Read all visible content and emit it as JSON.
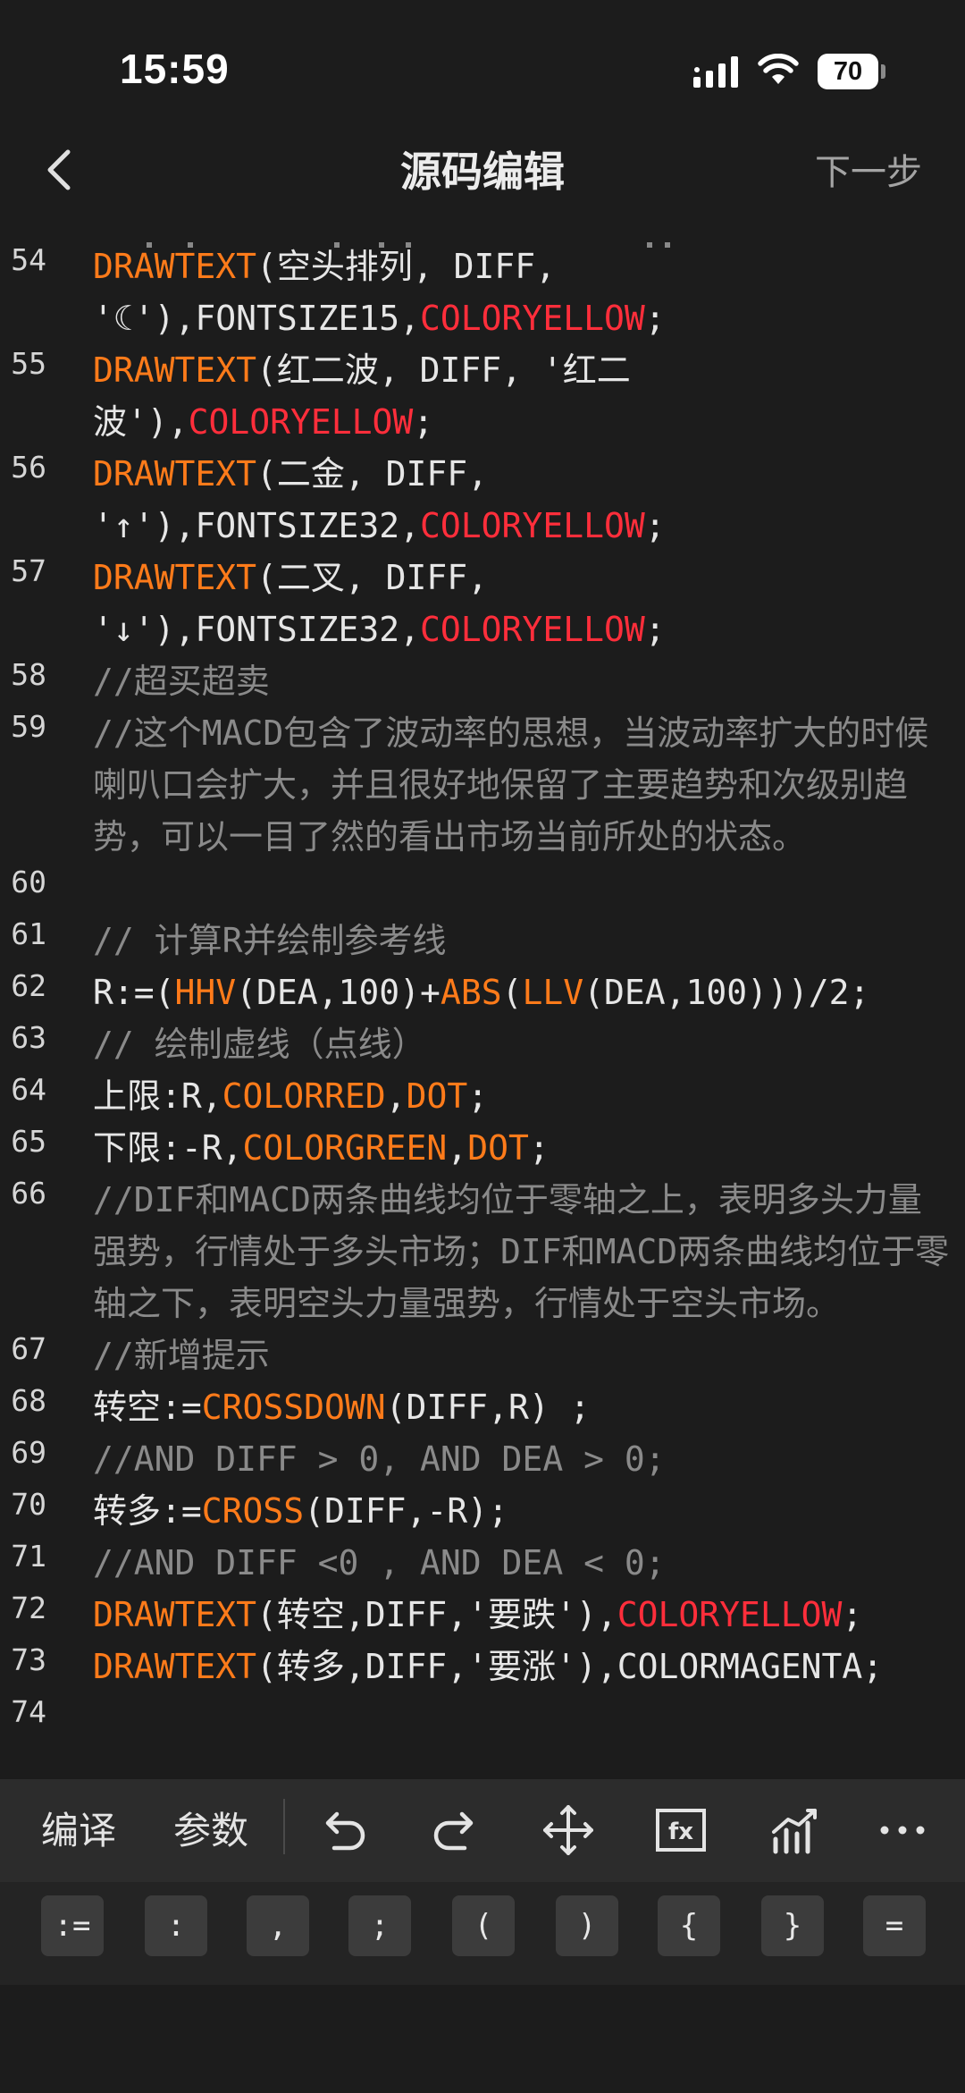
{
  "status_bar": {
    "time": "15:59",
    "battery": "70"
  },
  "nav": {
    "title": "源码编辑",
    "next_label": "下一步"
  },
  "editor": {
    "lines": [
      {
        "number": "54",
        "rows": [
          [
            [
              "fn",
              "DRAWTEXT"
            ],
            [
              "pl",
              "(空头排列, DIFF,"
            ]
          ],
          [
            [
              "pl",
              "'☾'),FONTSIZE15,"
            ],
            [
              "red",
              "COLORYELLOW"
            ],
            [
              "pl",
              ";"
            ]
          ]
        ]
      },
      {
        "number": "55",
        "rows": [
          [
            [
              "fn",
              "DRAWTEXT"
            ],
            [
              "pl",
              "(红二波, DIFF, '红二"
            ]
          ],
          [
            [
              "pl",
              "波'),"
            ],
            [
              "red",
              "COLORYELLOW"
            ],
            [
              "pl",
              ";"
            ]
          ]
        ]
      },
      {
        "number": "56",
        "rows": [
          [
            [
              "fn",
              "DRAWTEXT"
            ],
            [
              "pl",
              "(二金, DIFF,"
            ]
          ],
          [
            [
              "pl",
              "'↑'),FONTSIZE32,"
            ],
            [
              "red",
              "COLORYELLOW"
            ],
            [
              "pl",
              ";"
            ]
          ]
        ]
      },
      {
        "number": "57",
        "rows": [
          [
            [
              "fn",
              "DRAWTEXT"
            ],
            [
              "pl",
              "(二叉, DIFF,"
            ]
          ],
          [
            [
              "pl",
              "'↓'),FONTSIZE32,"
            ],
            [
              "red",
              "COLORYELLOW"
            ],
            [
              "pl",
              ";"
            ]
          ]
        ]
      },
      {
        "number": "58",
        "rows": [
          [
            [
              "cm",
              "//超买超卖"
            ]
          ]
        ]
      },
      {
        "number": "59",
        "rows": [
          [
            [
              "cm",
              "//这个MACD包含了波动率的思想，当波动率扩大的时候"
            ]
          ],
          [
            [
              "cm",
              "喇叭口会扩大，并且很好地保留了主要趋势和次级别趋"
            ]
          ],
          [
            [
              "cm",
              "势，可以一目了然的看出市场当前所处的状态。"
            ]
          ]
        ]
      },
      {
        "number": "60",
        "rows": [
          [
            [
              "pl",
              ""
            ]
          ]
        ]
      },
      {
        "number": "61",
        "rows": [
          [
            [
              "cm",
              "// 计算R并绘制参考线"
            ]
          ]
        ]
      },
      {
        "number": "62",
        "rows": [
          [
            [
              "pl",
              "R:=("
            ],
            [
              "fn",
              "HHV"
            ],
            [
              "pl",
              "(DEA,100)+"
            ],
            [
              "fn",
              "ABS"
            ],
            [
              "pl",
              "("
            ],
            [
              "fn",
              "LLV"
            ],
            [
              "pl",
              "(DEA,100)))/2;"
            ]
          ]
        ]
      },
      {
        "number": "63",
        "rows": [
          [
            [
              "cm",
              "// 绘制虚线（点线）"
            ]
          ]
        ]
      },
      {
        "number": "64",
        "rows": [
          [
            [
              "pl",
              "上限:R,"
            ],
            [
              "fn",
              "COLORRED"
            ],
            [
              "pl",
              ","
            ],
            [
              "fn",
              "DOT"
            ],
            [
              "pl",
              ";"
            ]
          ]
        ]
      },
      {
        "number": "65",
        "rows": [
          [
            [
              "pl",
              "下限:-R,"
            ],
            [
              "fn",
              "COLORGREEN"
            ],
            [
              "pl",
              ","
            ],
            [
              "fn",
              "DOT"
            ],
            [
              "pl",
              ";"
            ]
          ]
        ]
      },
      {
        "number": "66",
        "rows": [
          [
            [
              "cm",
              "//DIF和MACD两条曲线均位于零轴之上，表明多头力量"
            ]
          ],
          [
            [
              "cm",
              "强势，行情处于多头市场；DIF和MACD两条曲线均位于零"
            ]
          ],
          [
            [
              "cm",
              "轴之下，表明空头力量强势，行情处于空头市场。"
            ]
          ]
        ]
      },
      {
        "number": "67",
        "rows": [
          [
            [
              "cm",
              "//新增提示"
            ]
          ]
        ]
      },
      {
        "number": "68",
        "rows": [
          [
            [
              "pl",
              "转空:="
            ],
            [
              "fn",
              "CROSSDOWN"
            ],
            [
              "pl",
              "(DIFF,R) ;"
            ]
          ]
        ]
      },
      {
        "number": "69",
        "rows": [
          [
            [
              "cm",
              "//AND DIFF > 0, AND DEA > 0;"
            ]
          ]
        ]
      },
      {
        "number": "70",
        "rows": [
          [
            [
              "pl",
              "转多:="
            ],
            [
              "fn",
              "CROSS"
            ],
            [
              "pl",
              "(DIFF,-R);"
            ]
          ]
        ]
      },
      {
        "number": "71",
        "rows": [
          [
            [
              "cm",
              "//AND DIFF <0 , AND DEA < 0;"
            ]
          ]
        ]
      },
      {
        "number": "72",
        "rows": [
          [
            [
              "fn",
              "DRAWTEXT"
            ],
            [
              "pl",
              "(转空,DIFF,'要跌'),"
            ],
            [
              "red",
              "COLORYELLOW"
            ],
            [
              "pl",
              ";"
            ]
          ]
        ]
      },
      {
        "number": "73",
        "rows": [
          [
            [
              "fn",
              "DRAWTEXT"
            ],
            [
              "pl",
              "(转多,DIFF,'要涨'),COLORMAGENTA;"
            ]
          ]
        ]
      },
      {
        "number": "74",
        "rows": [
          [
            [
              "pl",
              ""
            ]
          ]
        ]
      }
    ]
  },
  "toolbar": {
    "compile_label": "编译",
    "params_label": "参数",
    "fx_label": "fx"
  },
  "symbols": [
    ":=",
    ":",
    ",",
    ";",
    "(",
    ")",
    "{",
    "}",
    "="
  ],
  "colors": {
    "function": "#ff7b1a",
    "keyword_red": "#ff2e3b",
    "comment": "#8a8a8a",
    "background": "#1c1c1c"
  }
}
